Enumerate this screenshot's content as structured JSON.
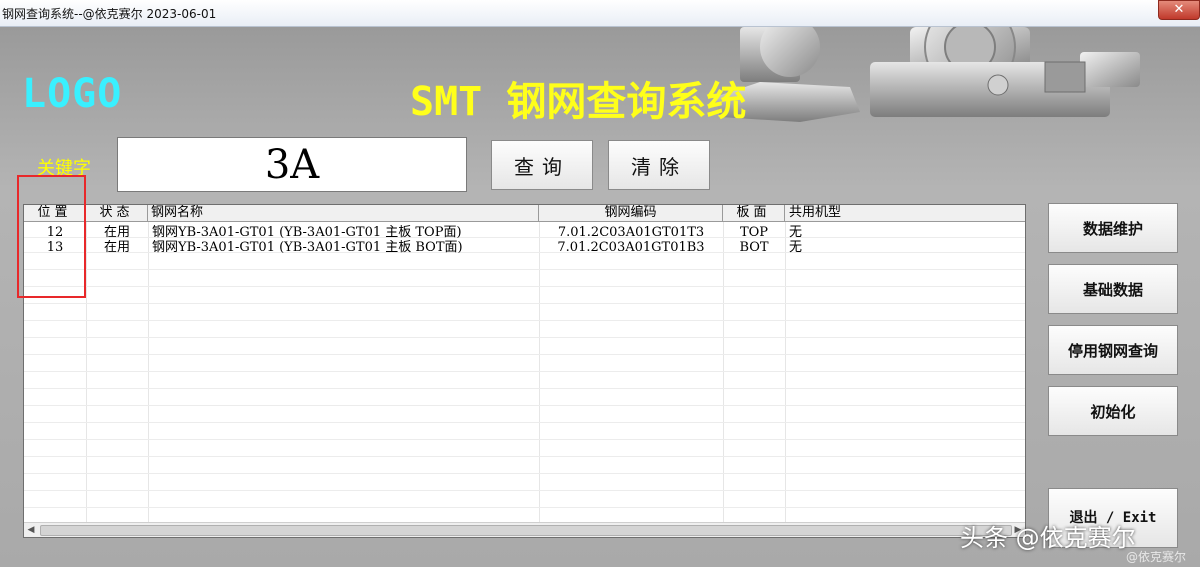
{
  "window": {
    "title": "钢网查询系统--@依克赛尔 2023-06-01",
    "close": "✕"
  },
  "header": {
    "logo": "LOGO",
    "title": "SMT 钢网查询系统"
  },
  "search": {
    "label": "关键字",
    "value": "3A",
    "query_button": "查询",
    "clear_button": "清除"
  },
  "table": {
    "columns": [
      "位置",
      "状态",
      "钢网名称",
      "钢网编码",
      "板面",
      "共用机型"
    ],
    "rows": [
      [
        "12",
        "在用",
        "钢网YB-3A01-GT01 (YB-3A01-GT01 主板 TOP面)",
        "7.01.2C03A01GT01T3",
        "TOP",
        "无"
      ],
      [
        "13",
        "在用",
        "钢网YB-3A01-GT01 (YB-3A01-GT01 主板 BOT面)",
        "7.01.2C03A01GT01B3",
        "BOT",
        "无"
      ]
    ]
  },
  "side_buttons": {
    "data_maintenance": "数据维护",
    "basic_data": "基础数据",
    "disabled_query": "停用钢网查询",
    "initialize": "初始化",
    "exit": "退出 / Exit"
  },
  "watermark": {
    "main": "头条 @依克赛尔",
    "small": "@依克赛尔"
  },
  "colors": {
    "logo": "#39f0ff",
    "title": "#ffff1a",
    "label": "#ffff00",
    "highlight_box": "#e8282a"
  }
}
